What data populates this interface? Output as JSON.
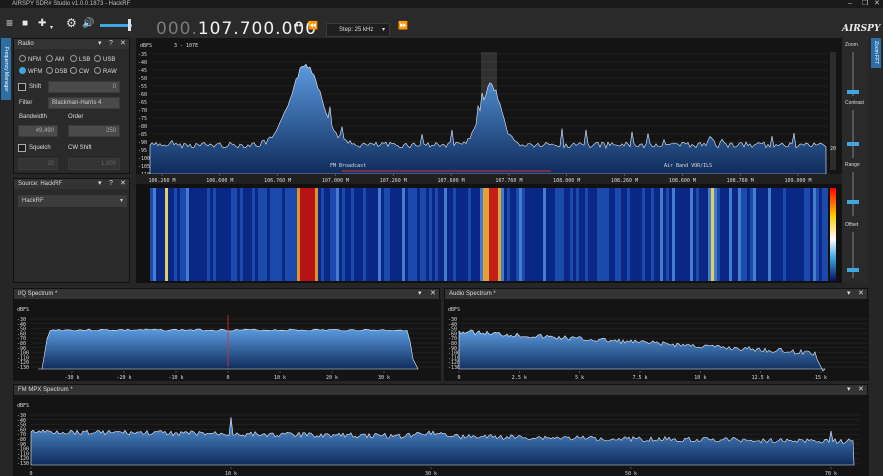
{
  "window": {
    "title": "AIRSPY SDR# Studio v1.0.0.1873 - HackRF",
    "min": "–",
    "max": "❐",
    "close": "✕"
  },
  "toolbar": {
    "menu_icon": "≡",
    "stop_icon": "■",
    "add_icon": "✚",
    "settings_icon": "⚙",
    "volume_icon": "🔊",
    "freq_dim": "000.",
    "freq_main": "107.700.000",
    "step_label": "Step: 25 kHz",
    "logo": "AIRSPY",
    "prev_icon": "⏮",
    "back_icon": "⏪",
    "fwd_icon": "⏩"
  },
  "left_tab": "Frequency Manager",
  "right_tab": "Zoom FFT",
  "radio_panel": {
    "title": "Radio",
    "modes": [
      "NFM",
      "AM",
      "LSB",
      "USB",
      "WFM",
      "DSB",
      "CW",
      "RAW"
    ],
    "selected": "WFM",
    "shift_label": "Shift",
    "shift_value": "0",
    "filter_label": "Filter",
    "filter_value": "Blackman-Harris 4",
    "bandwidth_label": "Bandwidth",
    "bandwidth_value": "49,490",
    "order_label": "Order",
    "order_value": "250",
    "squelch_label": "Squelch",
    "squelch_value": "20",
    "cw_label": "CW Shift",
    "cw_value": "1,000"
  },
  "source_panel": {
    "title": "Source: HackRF",
    "device": "HackRF"
  },
  "fft": {
    "unit": "dBFS",
    "marker": "3 - 107E",
    "y_labels": [
      "-35",
      "-40",
      "-45",
      "-50",
      "-55",
      "-60",
      "-65",
      "-70",
      "-75",
      "-80",
      "-85",
      "-90",
      "-95",
      "-100",
      "-105",
      "-110"
    ],
    "x_labels": [
      "106.260 M",
      "106.600 M",
      "106.760 M",
      "107.000 M",
      "107.260 M",
      "107.600 M",
      "107.760 M",
      "108.000 M",
      "108.260 M",
      "108.600 M",
      "108.760 M",
      "109.000 M"
    ],
    "band_labels": [
      "FM Broadcast",
      "Air Band VOR/ILS"
    ],
    "right_value": "20"
  },
  "sidebar": {
    "zoom": "Zoom",
    "contrast": "Contrast",
    "range": "Range",
    "offset": "Offset"
  },
  "iq_panel": {
    "title": "I/Q Spectrum *",
    "unit": "dBFS",
    "y_labels": [
      "-30",
      "-40",
      "-50",
      "-60",
      "-70",
      "-80",
      "-90",
      "-100",
      "-110",
      "-120",
      "-130"
    ],
    "x_labels": [
      "-30 k",
      "-20 k",
      "-10 k",
      "0",
      "10 k",
      "20 k",
      "30 k"
    ]
  },
  "audio_panel": {
    "title": "Audio Spectrum *",
    "unit": "dBFS",
    "y_labels": [
      "-30",
      "-40",
      "-50",
      "-60",
      "-70",
      "-80",
      "-90",
      "-100",
      "-110",
      "-120",
      "-130"
    ],
    "x_labels": [
      "0",
      "2.5 k",
      "5 k",
      "7.5 k",
      "10 k",
      "12.5 k",
      "15 k"
    ]
  },
  "mpx_panel": {
    "title": "FM MPX Spectrum *",
    "unit": "dBFS",
    "y_labels": [
      "-30",
      "-40",
      "-50",
      "-60",
      "-70",
      "-80",
      "-90",
      "-100",
      "-110",
      "-120",
      "-130"
    ],
    "x_labels": [
      "0",
      "10 k",
      "30 k",
      "50 k",
      "70 k"
    ]
  },
  "panel_icons": {
    "pin": "▾",
    "close": "✕",
    "help": "?"
  },
  "colors": {
    "accent": "#3fa6e0",
    "spectrum_fill": "#3f7fc4",
    "spectrum_line": "#e8eef7"
  }
}
